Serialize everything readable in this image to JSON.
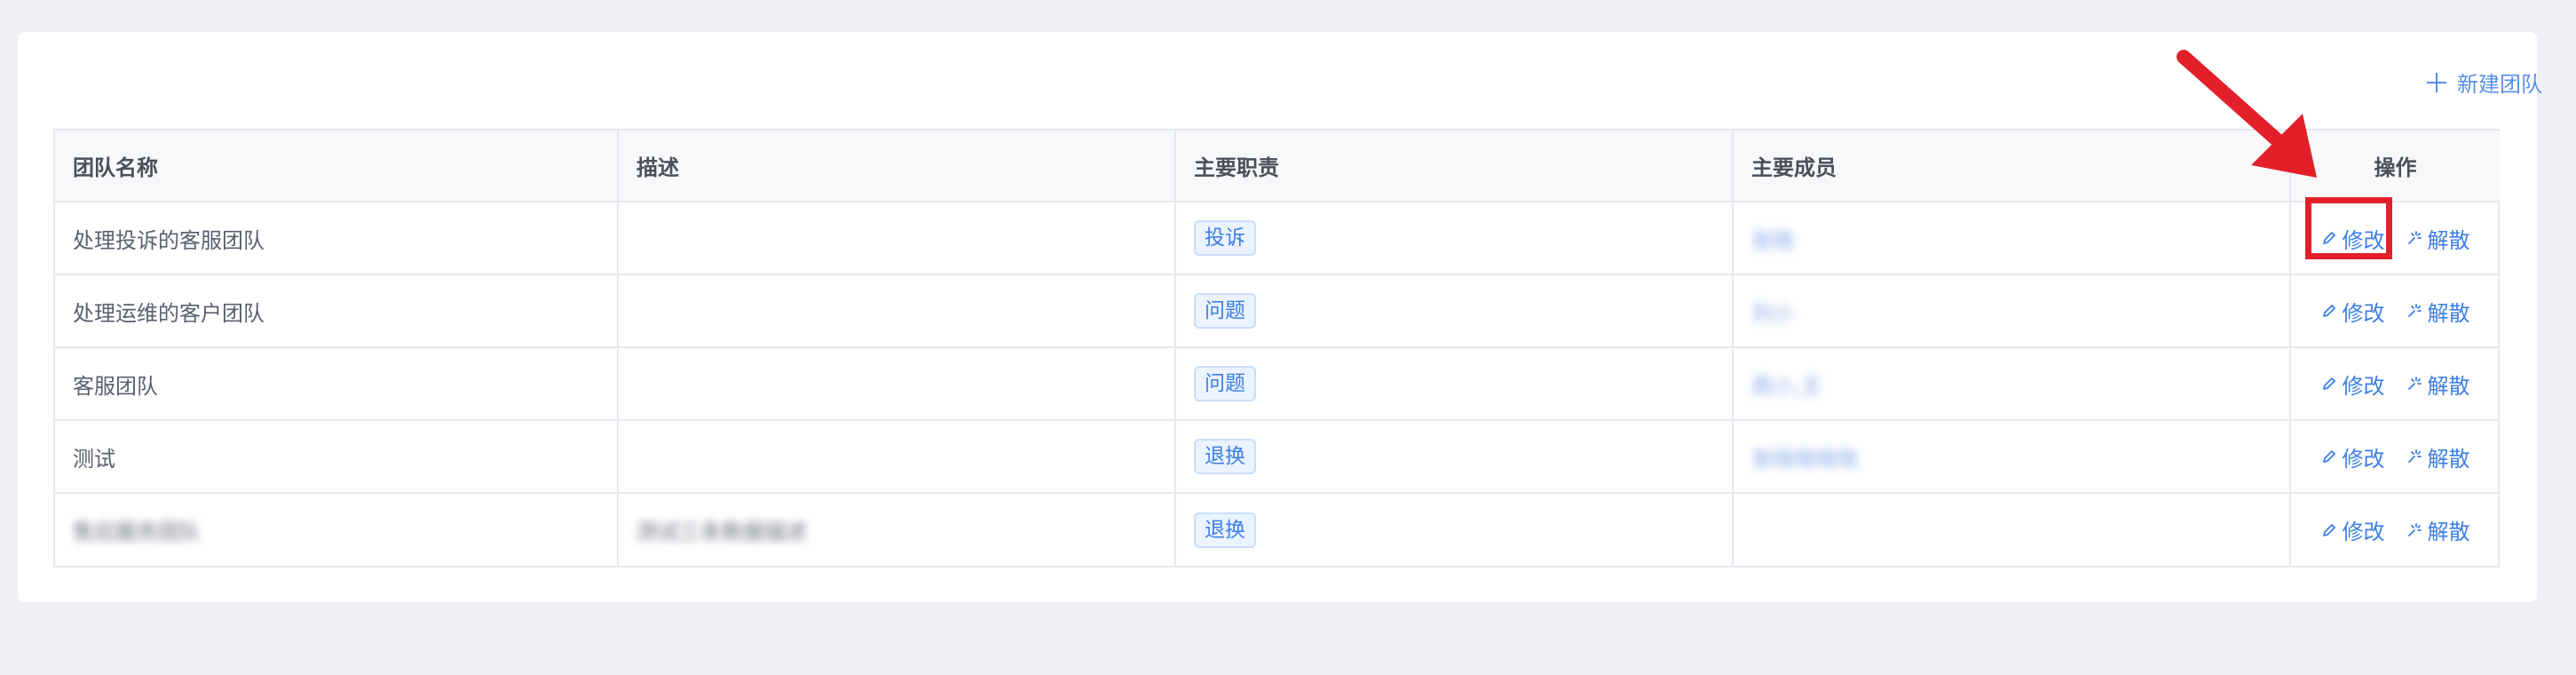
{
  "toolbar": {
    "add_team_label": "新建团队"
  },
  "table": {
    "columns": [
      "团队名称",
      "描述",
      "主要职责",
      "主要成员",
      "操作"
    ],
    "rows": [
      {
        "name": "处理投诉的客服团队",
        "description": "",
        "duty": "投诉",
        "member": "张晓",
        "edit": "修改",
        "dissolve": "解散"
      },
      {
        "name": "处理运维的客户团队",
        "description": "",
        "duty": "问题",
        "member": "刘小",
        "edit": "修改",
        "dissolve": "解散"
      },
      {
        "name": "客服团队",
        "description": "",
        "duty": "问题",
        "member": "周小,王",
        "edit": "修改",
        "dissolve": "解散"
      },
      {
        "name": "测试",
        "description": "",
        "duty": "退换",
        "member": "张晓晓晓晓",
        "edit": "修改",
        "dissolve": "解散"
      },
      {
        "name": "售后服务团队",
        "description": "测试三条数据描述",
        "duty": "退换",
        "member": "",
        "edit": "修改",
        "dissolve": "解散"
      }
    ]
  },
  "annotation": {
    "color": "#e3202a"
  },
  "colors": {
    "accent": "#3d7fe5",
    "tag_bg": "#eaf3ff",
    "background": "#eef0f4"
  }
}
